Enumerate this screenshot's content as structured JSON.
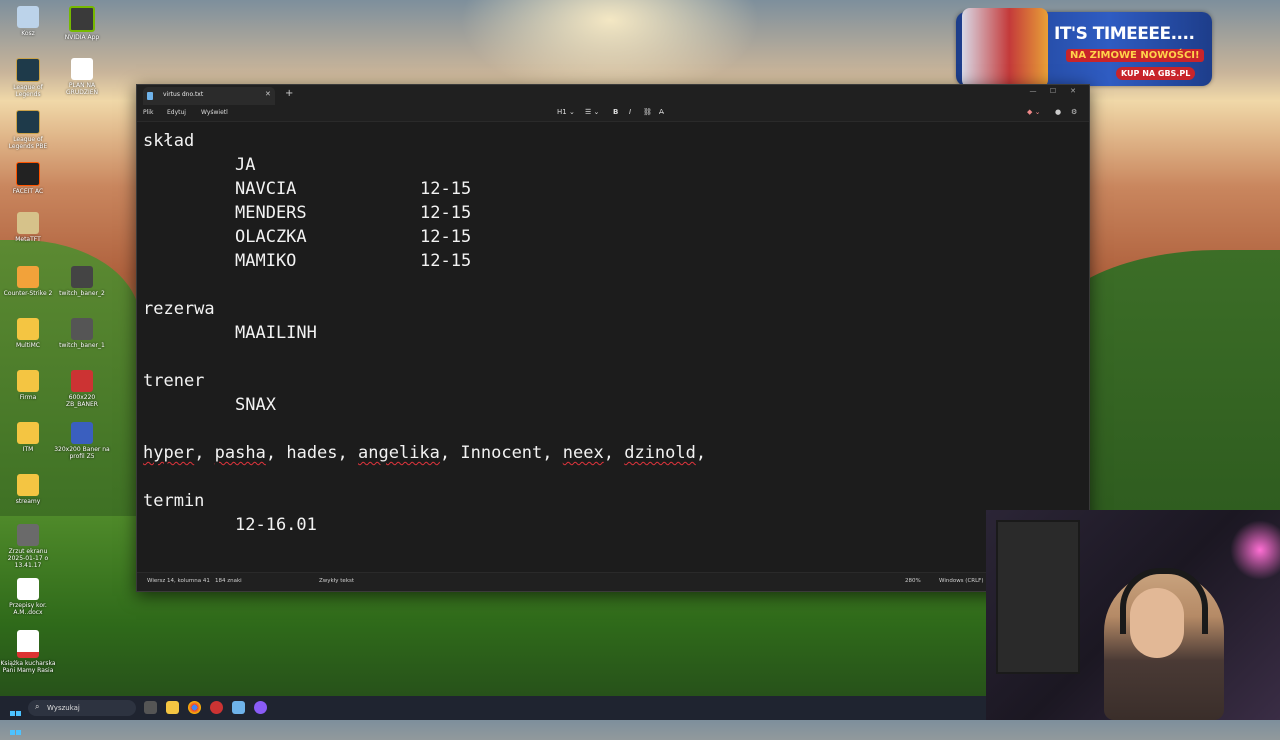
{
  "desktop": {
    "icons": [
      {
        "label": "Kosz"
      },
      {
        "label": "NVIDIA App"
      },
      {
        "label": "League of Legends"
      },
      {
        "label": "PLAN NA GRUDZIEŃ"
      },
      {
        "label": "League of Legends PBE"
      },
      {
        "label": "FACEIT AC"
      },
      {
        "label": "MetaTFT"
      },
      {
        "label": "Counter-Strike 2"
      },
      {
        "label": "twitch_baner_2"
      },
      {
        "label": "MultiMC"
      },
      {
        "label": "twitch_baner_1"
      },
      {
        "label": "Firma"
      },
      {
        "label": "600x220 ZB_BANER"
      },
      {
        "label": "ITM"
      },
      {
        "label": "320x200 Baner na profil Z5"
      },
      {
        "label": "streamy"
      },
      {
        "label": "Zrzut ekranu 2025-01-17 o 13.41.17"
      },
      {
        "label": "Przepisy kor. A.M..docx"
      },
      {
        "label": "Książka kucharska Pani Mamy Rasia"
      }
    ]
  },
  "ad": {
    "headline": "IT'S TIMEEEE....",
    "sub": "NA ZIMOWE NOWOŚCI!",
    "cta": "KUP NA GBS.PL"
  },
  "notepad": {
    "tab_title": "virtus dno.txt",
    "menu": {
      "file": "Plik",
      "edit": "Edytuj",
      "view": "Wyświetl"
    },
    "format": {
      "heading": "H1",
      "list": "☰",
      "bold": "B",
      "italic": "I",
      "link": "🔗",
      "clear": "A̶"
    },
    "lines": {
      "l1": "skład",
      "l2": "JA",
      "r1_name": "NAVCIA",
      "r1_val": "12-15",
      "r2_name": "MENDERS",
      "r2_val": "12-15",
      "r3_name": "OLACZKA",
      "r3_val": "12-15",
      "r4_name": "MAMIKO",
      "r4_val": "12-15",
      "rez": "rezerwa",
      "rez_name": "MAAILINH",
      "trener": "trener",
      "trener_name": "SNAX",
      "n1": "hyper",
      "n2": "pasha",
      "n3": "hades",
      "n4": "angelika",
      "n5": "Innocent",
      "n6": "neex",
      "n7": "dzinold",
      "termin": "termin",
      "termin_val": "12-16.01"
    },
    "status": {
      "position": "Wiersz 14, kolumna 41",
      "chars": "184 znaki",
      "format": "Zwykły tekst",
      "zoom": "280%",
      "eol": "Windows (CRLF)"
    }
  },
  "taskbar": {
    "search_placeholder": "Wyszukaj"
  }
}
